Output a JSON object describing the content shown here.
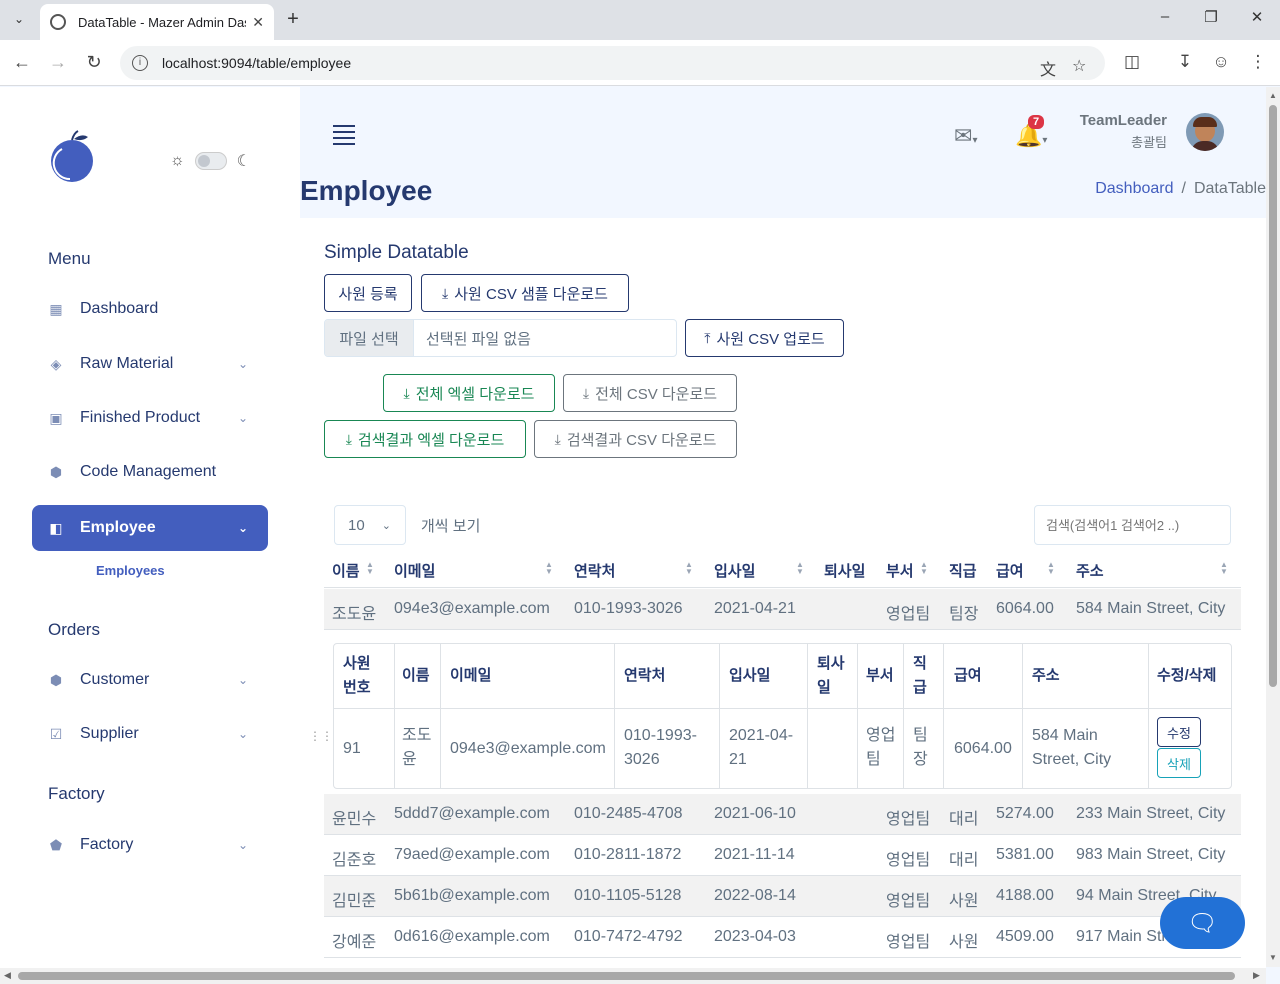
{
  "browser": {
    "tab_title": "DataTable - Mazer Admin Das",
    "url": "localhost:9094/table/employee"
  },
  "sidebar": {
    "sections": {
      "menu": "Menu",
      "orders": "Orders",
      "factory": "Factory"
    },
    "items": [
      {
        "label": "Dashboard",
        "icon": "grid-icon"
      },
      {
        "label": "Raw Material",
        "icon": "stack-icon"
      },
      {
        "label": "Finished Product",
        "icon": "briefcase-icon"
      },
      {
        "label": "Code Management",
        "icon": "hexagon-icon"
      },
      {
        "label": "Employee",
        "icon": "layout-icon"
      },
      {
        "label": "Customer",
        "icon": "hexagon-icon"
      },
      {
        "label": "Supplier",
        "icon": "checklist-icon"
      },
      {
        "label": "Factory",
        "icon": "pentagon-icon"
      }
    ],
    "submenu_label": "Employees"
  },
  "header": {
    "notif_count": "7",
    "user_name": "TeamLeader",
    "user_role": "총괄팀"
  },
  "page": {
    "title": "Employee",
    "breadcrumb": [
      "Dashboard",
      "/",
      "DataTable"
    ]
  },
  "card": {
    "title": "Simple Datatable",
    "buttons": {
      "register": "사원 등록",
      "csv_sample": "사원 CSV 샘플 다운로드",
      "file_choose": "파일 선택",
      "file_none": "선택된 파일 없음",
      "csv_upload": "사원 CSV 업로드",
      "excel_all": "전체 엑셀 다운로드",
      "csv_all": "전체 CSV 다운로드",
      "excel_search": "검색결과 엑셀 다운로드",
      "csv_search": "검색결과 CSV 다운로드"
    },
    "per_page": "10",
    "per_page_label": "개씩 보기",
    "search_placeholder": "검색(검색어1 검색어2 ..)"
  },
  "table": {
    "headers": [
      "이름",
      "이메일",
      "연락처",
      "입사일",
      "퇴사일",
      "부서",
      "직급",
      "급여",
      "주소"
    ],
    "rows": [
      [
        "조도윤",
        "094e3@example.com",
        "010-1993-3026",
        "2021-04-21",
        "",
        "영업팀",
        "팀장",
        "6064.00",
        "584 Main Street, City"
      ],
      [
        "윤민수",
        "5ddd7@example.com",
        "010-2485-4708",
        "2021-06-10",
        "",
        "영업팀",
        "대리",
        "5274.00",
        "233 Main Street, City"
      ],
      [
        "김준호",
        "79aed@example.com",
        "010-2811-1872",
        "2021-11-14",
        "",
        "영업팀",
        "대리",
        "5381.00",
        "983 Main Street, City"
      ],
      [
        "김민준",
        "5b61b@example.com",
        "010-1105-5128",
        "2022-08-14",
        "",
        "영업팀",
        "사원",
        "4188.00",
        "94 Main Street, City"
      ],
      [
        "강예준",
        "0d616@example.com",
        "010-7472-4792",
        "2023-04-03",
        "",
        "영업팀",
        "사원",
        "4509.00",
        "917 Main Street, City"
      ]
    ]
  },
  "detail": {
    "headers": {
      "emp_no": [
        "사원",
        "번호"
      ],
      "name": "이름",
      "email": "이메일",
      "phone": "연락처",
      "hire": "입사일",
      "leave": [
        "퇴사",
        "일"
      ],
      "dept": "부서",
      "rank": [
        "직",
        "급"
      ],
      "salary": "급여",
      "address": "주소",
      "actions": "수정/삭제"
    },
    "values": {
      "emp_no": "91",
      "name": [
        "조도",
        "윤"
      ],
      "email": "094e3@example.com",
      "phone": [
        "010-1993-",
        "3026"
      ],
      "hire": [
        "2021-04-",
        "21"
      ],
      "leave": "",
      "dept": [
        "영업",
        "팀"
      ],
      "rank": [
        "팀",
        "장"
      ],
      "salary": "6064.00",
      "address": [
        "584 Main",
        "Street, City"
      ]
    },
    "edit_label": "수정",
    "delete_label": "삭제"
  }
}
